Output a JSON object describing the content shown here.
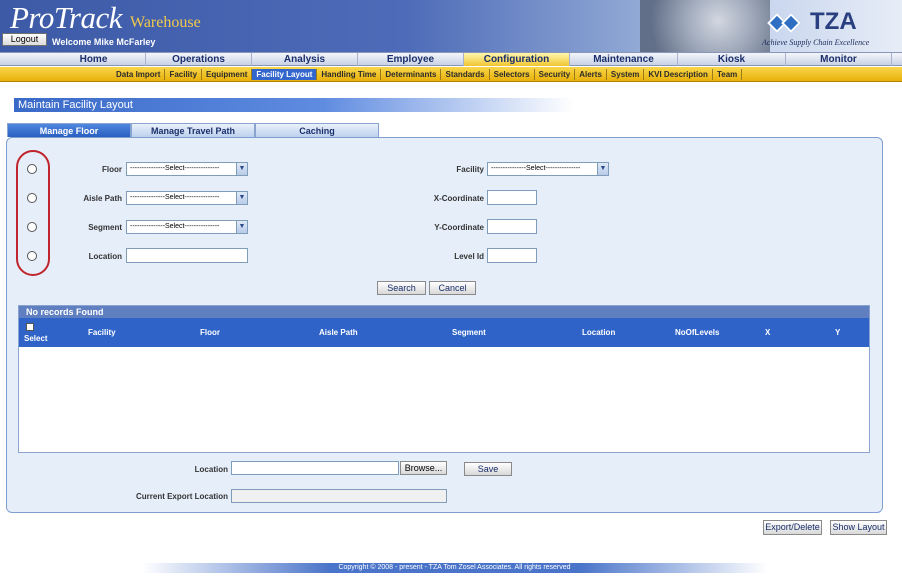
{
  "header": {
    "brand": "ProTrack",
    "brand_sub": "Warehouse",
    "logout_label": "Logout",
    "welcome": "Welcome Mike McFarley",
    "company": "TZA",
    "tagline": "Achieve Supply Chain Excellence"
  },
  "main_nav": {
    "items": [
      "Home",
      "Operations",
      "Analysis",
      "Employee",
      "Configuration",
      "Maintenance",
      "Kiosk",
      "Monitor"
    ],
    "active": "Configuration"
  },
  "sub_nav": {
    "items": [
      "Data Import",
      "Facility",
      "Equipment",
      "Facility Layout",
      "Handling Time",
      "Determinants",
      "Standards",
      "Selectors",
      "Security",
      "Alerts",
      "System",
      "KVI Description",
      "Team"
    ],
    "active": "Facility Layout"
  },
  "page_title": "Maintain Facility Layout",
  "tabs": [
    "Manage Floor",
    "Manage Travel Path",
    "Caching"
  ],
  "active_tab": "Manage Floor",
  "form": {
    "floor_label": "Floor",
    "floor_value": "---------------Select---------------",
    "aisle_path_label": "Aisle Path",
    "aisle_path_value": "---------------Select---------------",
    "segment_label": "Segment",
    "segment_value": "---------------Select---------------",
    "location_label": "Location",
    "location_value": "",
    "facility_label": "Facility",
    "facility_value": "---------------Select---------------",
    "x_label": "X-Coordinate",
    "x_value": "",
    "y_label": "Y-Coordinate",
    "y_value": "",
    "level_label": "Level Id",
    "level_value": "",
    "search_label": "Search",
    "cancel_label": "Cancel"
  },
  "grid": {
    "caption": "No records Found",
    "select_label": "Select",
    "columns": [
      "Facility",
      "Floor",
      "Aisle Path",
      "Segment",
      "Location",
      "NoOfLevels",
      "X",
      "Y"
    ]
  },
  "export": {
    "location_label": "Location",
    "browse_label": "Browse...",
    "save_label": "Save",
    "current_label": "Current Export Location",
    "current_value": ""
  },
  "actions": {
    "export_delete": "Export/Delete",
    "show_layout": "Show Layout"
  },
  "footer": {
    "copyright": "Copyright © 2008 - present - TZA Tom Zosel Associates. All rights reserved"
  }
}
